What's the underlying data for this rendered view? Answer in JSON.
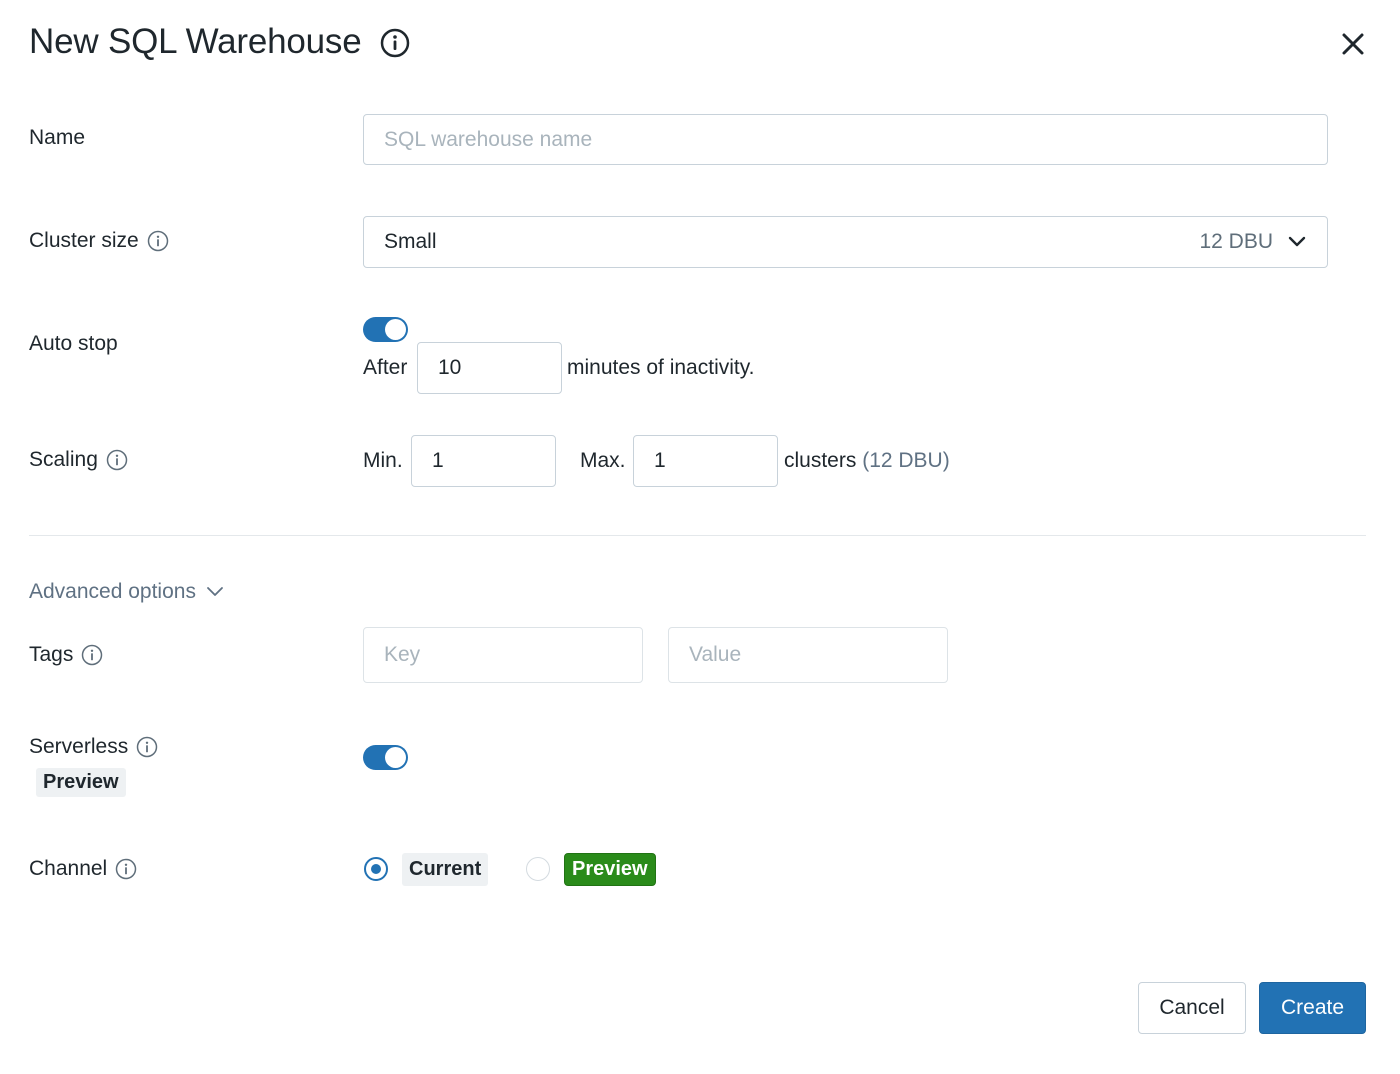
{
  "dialog": {
    "title": "New SQL Warehouse"
  },
  "name": {
    "label": "Name",
    "placeholder": "SQL warehouse name",
    "value": ""
  },
  "cluster_size": {
    "label": "Cluster size",
    "value": "Small",
    "dbu": "12 DBU"
  },
  "auto_stop": {
    "label": "Auto stop",
    "enabled": true,
    "prefix": "After",
    "minutes": "10",
    "suffix": "minutes of inactivity."
  },
  "scaling": {
    "label": "Scaling",
    "min_label": "Min.",
    "min_value": "1",
    "max_label": "Max.",
    "max_value": "1",
    "clusters_text": "clusters",
    "dbu_text": "(12 DBU)"
  },
  "advanced": {
    "label": "Advanced options"
  },
  "tags": {
    "label": "Tags",
    "key_placeholder": "Key",
    "value_placeholder": "Value"
  },
  "serverless": {
    "label": "Serverless",
    "badge": "Preview",
    "enabled": true
  },
  "channel": {
    "label": "Channel",
    "options": [
      {
        "label": "Current",
        "selected": true
      },
      {
        "label": "Preview",
        "selected": false
      }
    ]
  },
  "footer": {
    "cancel_label": "Cancel",
    "create_label": "Create"
  },
  "colors": {
    "accent": "#2272b4",
    "preview_green": "#2a8b1a",
    "muted_text": "#5f7183"
  }
}
